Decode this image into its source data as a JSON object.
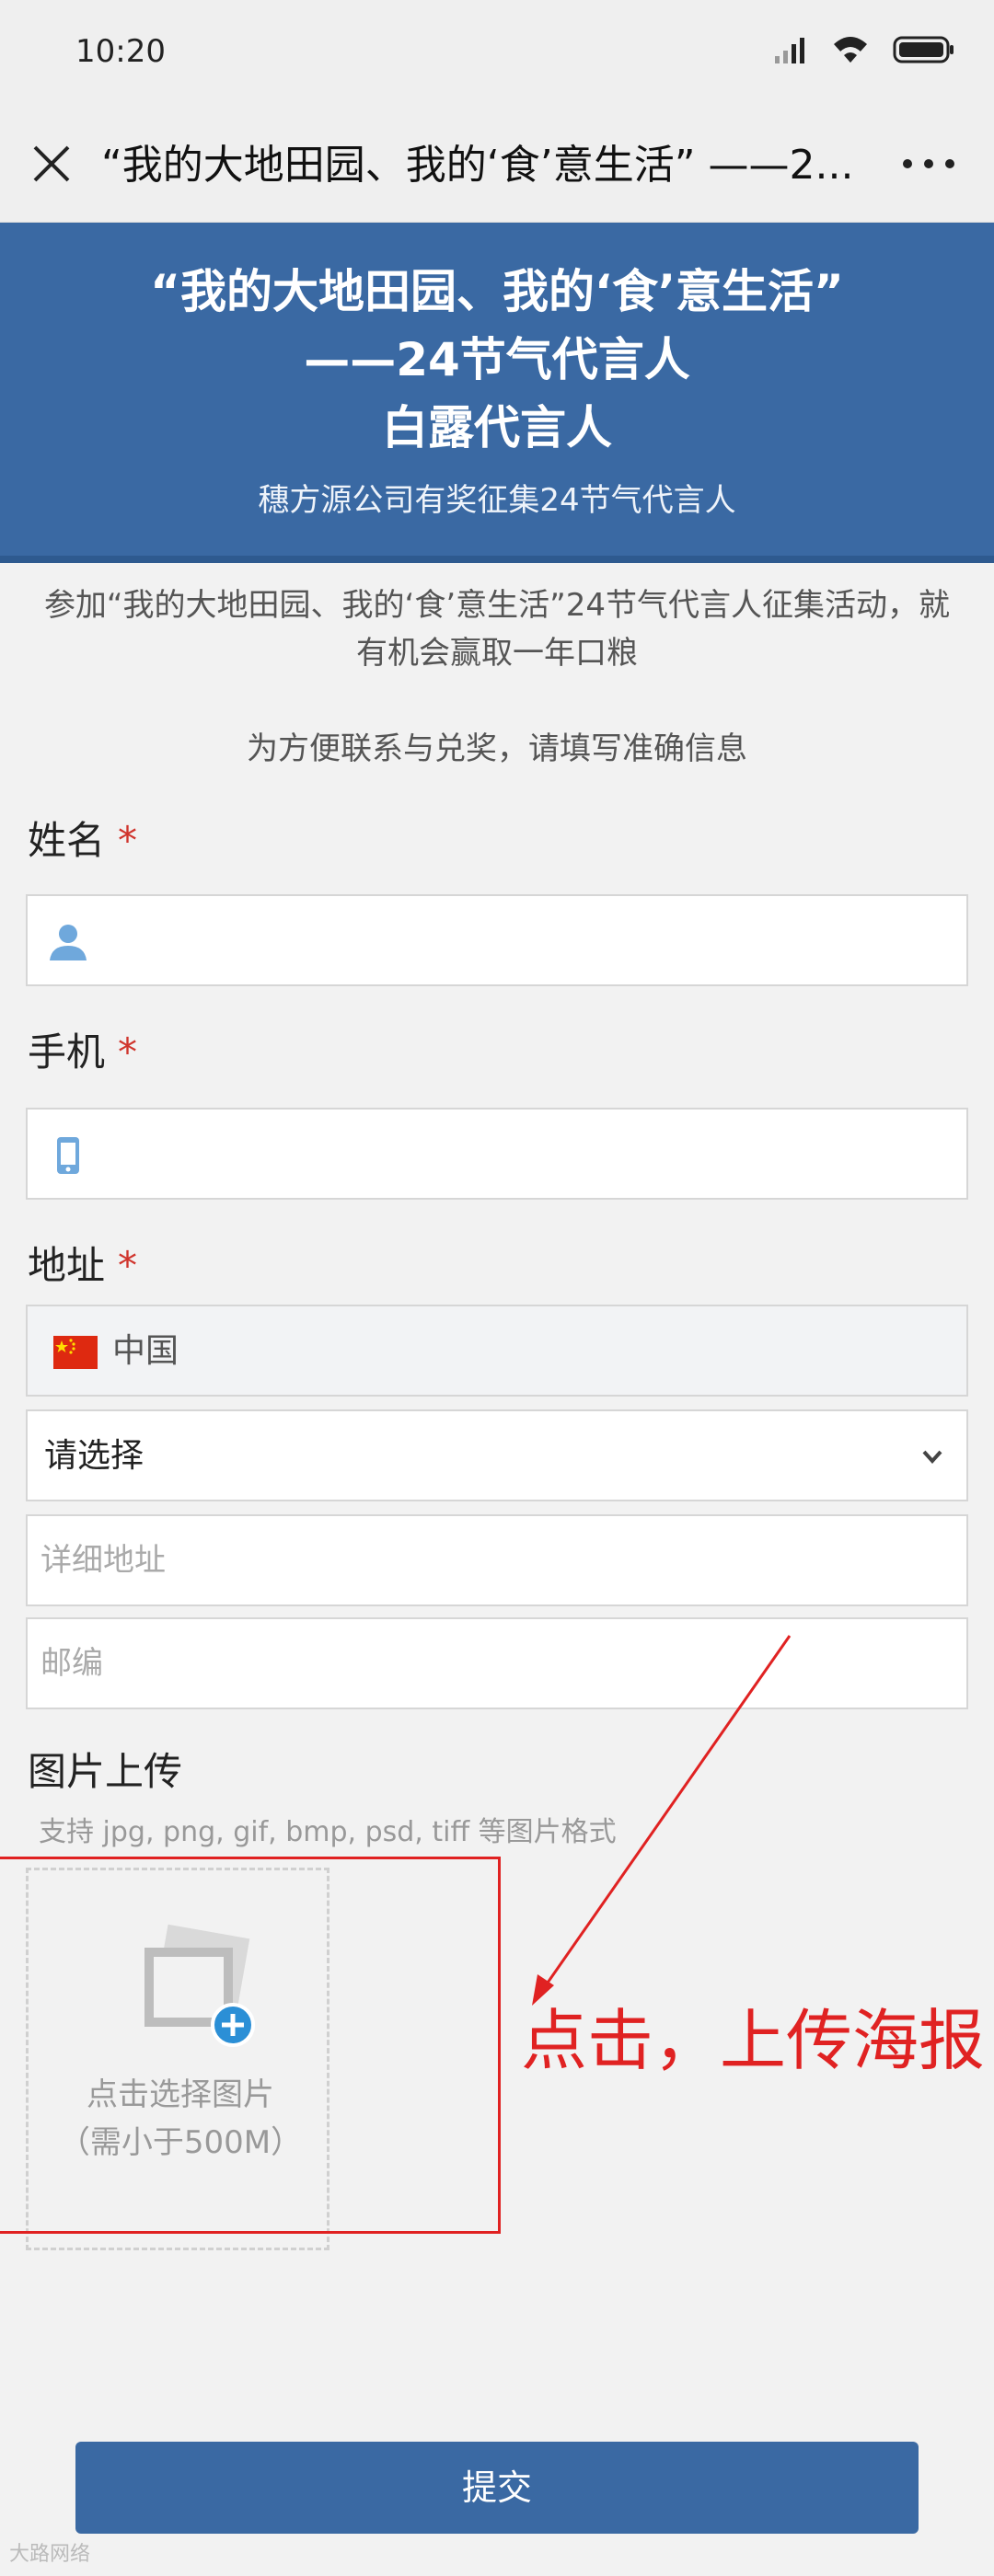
{
  "status_bar": {
    "time": "10:20"
  },
  "nav": {
    "title": "“我的大地田园、我的‘食’意生活” ——2...",
    "close_icon": "close-icon",
    "more_icon": "more-icon"
  },
  "banner": {
    "title_line1": "“我的大地田园、我的‘食’意生活”",
    "title_line2": "——24节气代言人",
    "title_line3": "白露代言人",
    "subtitle": "穗方源公司有奖征集24节气代言人",
    "color": "#3a69a3"
  },
  "intro": "参加“我的大地田园、我的‘食’意生活”24节气代言人征集活动，就有机会赢取一年口粮",
  "notice": "为方便联系与兑奖，请填写准确信息",
  "form": {
    "name": {
      "label": "姓名",
      "required_mark": "*",
      "icon": "person-icon",
      "value": ""
    },
    "phone": {
      "label": "手机",
      "required_mark": "*",
      "icon": "phone-icon",
      "value": ""
    },
    "address": {
      "label": "地址",
      "required_mark": "*",
      "country": "中国",
      "region_select": "请选择",
      "detail_placeholder": "详细地址",
      "zipcode_placeholder": "邮编"
    },
    "upload": {
      "label": "图片上传",
      "hint": "支持 jpg, png, gif, bmp, psd, tiff 等图片格式",
      "box_line1": "点击选择图片",
      "box_line2": "（需小于500M）",
      "icon": "image-add-icon"
    },
    "submit_label": "提交"
  },
  "annotation": {
    "text": "点击，上传海报",
    "color": "#e02222"
  },
  "watermark": "大路网络"
}
